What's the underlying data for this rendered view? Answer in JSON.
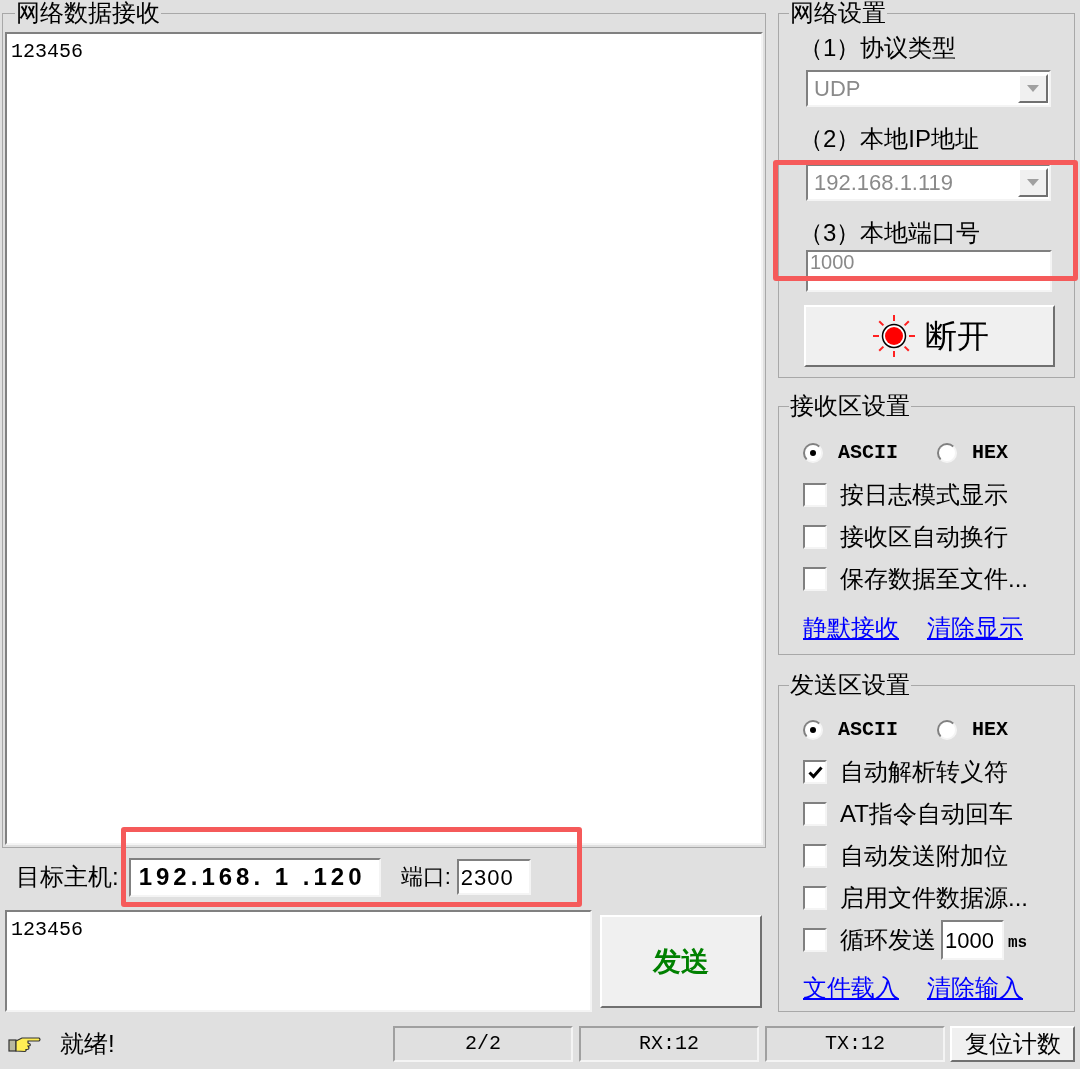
{
  "receive_panel": {
    "title": "网络数据接收",
    "text": "123456"
  },
  "target": {
    "host_label": "目标主机:",
    "host_value": "192.168. 1 .120",
    "port_label": "端口:",
    "port_value": "2300"
  },
  "send_panel": {
    "text": "123456",
    "button": "发送"
  },
  "network_settings": {
    "title": "网络设置",
    "fields": [
      {
        "kind": "combo",
        "label": "（1）协议类型",
        "value": "UDP",
        "disabled": true
      },
      {
        "kind": "combo",
        "label": "（2）本地IP地址",
        "value": "192.168.1.119",
        "disabled": true
      },
      {
        "kind": "input",
        "label": "（3）本地端口号",
        "value": "1000",
        "disabled": true
      }
    ],
    "connect_button": {
      "label": "断开"
    }
  },
  "receive_settings": {
    "title": "接收区设置",
    "encoding": [
      {
        "label": "ASCII",
        "selected": true
      },
      {
        "label": "HEX",
        "selected": false
      }
    ],
    "options": [
      {
        "kind": "checkbox",
        "label": "按日志模式显示",
        "checked": false
      },
      {
        "kind": "checkbox",
        "label": "接收区自动换行",
        "checked": false
      },
      {
        "kind": "checkbox",
        "label": "保存数据至文件...",
        "checked": false
      }
    ],
    "links": [
      "静默接收",
      "清除显示"
    ]
  },
  "send_settings": {
    "title": "发送区设置",
    "encoding": [
      {
        "label": "ASCII",
        "selected": true
      },
      {
        "label": "HEX",
        "selected": false
      }
    ],
    "options": [
      {
        "kind": "checkbox",
        "label": "自动解析转义符",
        "checked": true
      },
      {
        "kind": "checkbox",
        "label": "AT指令自动回车",
        "checked": false
      },
      {
        "kind": "checkbox",
        "label": "自动发送附加位",
        "checked": false
      },
      {
        "kind": "checkbox",
        "label": "启用文件数据源...",
        "checked": false
      },
      {
        "kind": "interval",
        "label": "循环发送",
        "checked": false,
        "value": "1000",
        "unit": "ms"
      }
    ],
    "links": [
      "文件载入",
      "清除输入"
    ]
  },
  "status_bar": {
    "message": "就绪!",
    "panels": [
      "2/2",
      "RX:12",
      "TX:12"
    ],
    "reset_button": "复位计数"
  }
}
